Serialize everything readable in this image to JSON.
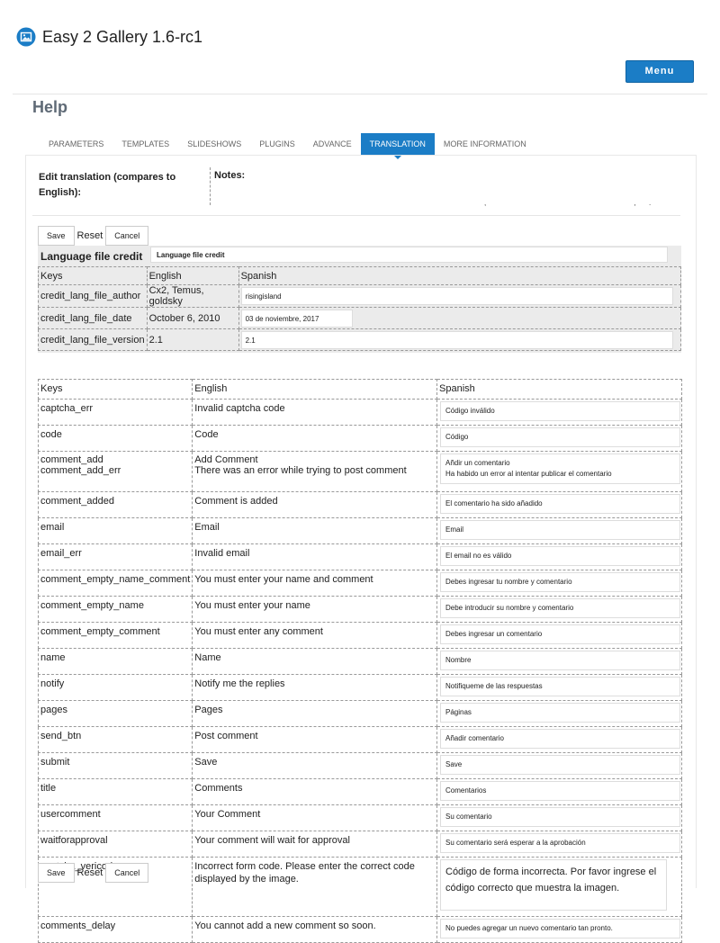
{
  "app": {
    "title": "Easy 2 Gallery 1.6-rc1",
    "menu_label": "Menu"
  },
  "page": {
    "heading": "Help"
  },
  "tabs": [
    {
      "label": "PARAMETERS",
      "active": false
    },
    {
      "label": "TEMPLATES",
      "active": false
    },
    {
      "label": "SLIDESHOWS",
      "active": false
    },
    {
      "label": "PLUGINS",
      "active": false
    },
    {
      "label": "ADVANCE",
      "active": false
    },
    {
      "label": "TRANSLATION",
      "active": true
    },
    {
      "label": "MORE INFORMATION",
      "active": false
    }
  ],
  "translation": {
    "edit_label": "Edit translation (compares to English):",
    "notes_label": "Notes:",
    "notes_hint": [
      ",",
      ",",
      "."
    ]
  },
  "buttons": {
    "save": "Save",
    "reset": "Reset",
    "cancel": "Cancel"
  },
  "credit": {
    "title": "Language file credit",
    "title_value": "Language file credit",
    "headers": {
      "keys": "Keys",
      "english": "English",
      "spanish": "Spanish"
    },
    "rows": [
      {
        "key": "credit_lang_file_author",
        "english": "Cx2, Temus, goldsky",
        "spanish": "risingisland"
      },
      {
        "key": "credit_lang_file_date",
        "english": "October 6, 2010",
        "spanish": "03 de noviembre, 2017"
      },
      {
        "key": "credit_lang_file_version",
        "english": "2.1",
        "spanish": "2.1"
      }
    ]
  },
  "strings": {
    "headers": {
      "keys": "Keys",
      "english": "English",
      "spanish": "Spanish"
    },
    "rows": [
      {
        "key": "captcha_err",
        "english": "Invalid captcha code",
        "spanish": "Código inválido"
      },
      {
        "key": "code",
        "english": "Code",
        "spanish": "Código"
      },
      {
        "key": "comment_add",
        "english": "Add Comment",
        "spanish": "Añdir un comentario",
        "key2": "comment_add_err",
        "english2": "There was an error while trying to post comment",
        "spanish2": "Ha habido un  error al intentar publicar el comentario"
      },
      {
        "key": "comment_added",
        "english": "Comment is added",
        "spanish": "El comentario ha sido añadido"
      },
      {
        "key": "email",
        "english": "Email",
        "spanish": "Email"
      },
      {
        "key": "email_err",
        "english": "Invalid email",
        "spanish": "El email no es válido"
      },
      {
        "key": "comment_empty_name_comment",
        "english": "You must enter your name and comment",
        "spanish": "Debes ingresar tu nombre y comentario"
      },
      {
        "key": "comment_empty_name",
        "english": "You must enter your name",
        "spanish": "Debe introducir su nombre y comentario"
      },
      {
        "key": "comment_empty_comment",
        "english": "You must enter any comment",
        "spanish": "Debes ingresar un comentario"
      },
      {
        "key": "name",
        "english": "Name",
        "spanish": "Nombre"
      },
      {
        "key": "notify",
        "english": "Notify me the replies",
        "spanish": "Notifiqueme de las respuestas"
      },
      {
        "key": "pages",
        "english": "Pages",
        "spanish": "Páginas"
      },
      {
        "key": "send_btn",
        "english": "Post comment",
        "spanish": "Añadir comentario"
      },
      {
        "key": "submit",
        "english": "Save",
        "spanish": "Save"
      },
      {
        "key": "title",
        "english": "Comments",
        "spanish": "Comentarios"
      },
      {
        "key": "usercomment",
        "english": "Your Comment",
        "spanish": "Su comentario"
      },
      {
        "key": "waitforapproval",
        "english": "Your comment will wait for approval",
        "spanish": "Su comentario será esperar a la aprobación"
      },
      {
        "key": "captcha_vericode_err",
        "english": "Incorrect form code. Please enter the correct code displayed by the image.",
        "spanish": "Código de forma incorrecta. Por favor ingrese el código correcto que muestra la imagen."
      },
      {
        "key": "comments_delay",
        "english": "You cannot add a new comment so soon.",
        "spanish": "No puedes agregar un nuevo comentario tan pronto."
      }
    ]
  },
  "colors": {
    "accent": "#1b7dc6",
    "heading": "#5f6a76"
  }
}
